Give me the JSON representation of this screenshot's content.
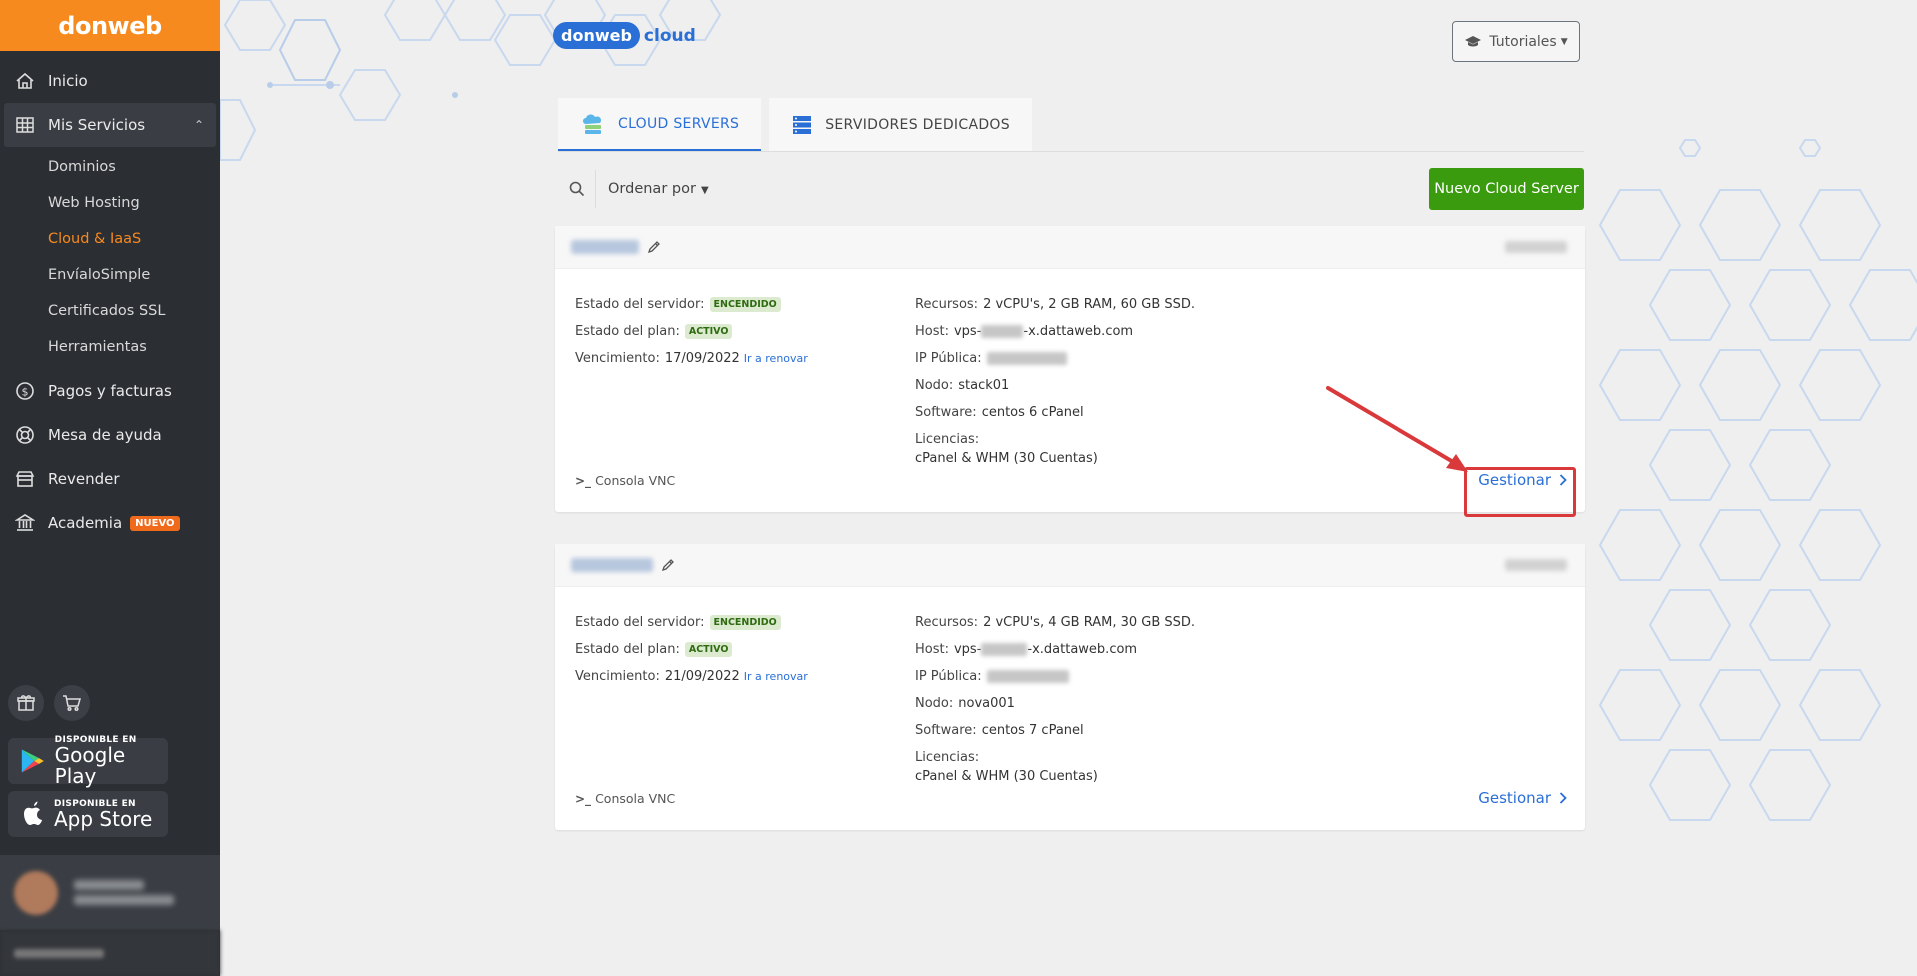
{
  "sidebar": {
    "brand": "donweb",
    "items": [
      {
        "label": "Inicio",
        "icon": "home-icon"
      },
      {
        "label": "Mis Servicios",
        "icon": "grid-icon"
      },
      {
        "label": "Pagos y facturas",
        "icon": "dollar-circle-icon"
      },
      {
        "label": "Mesa de ayuda",
        "icon": "lifebuoy-icon"
      },
      {
        "label": "Revender",
        "icon": "store-icon"
      },
      {
        "label": "Academia",
        "icon": "bank-icon",
        "badge": "NUEVO"
      }
    ],
    "submenu": [
      {
        "label": "Dominios"
      },
      {
        "label": "Web Hosting"
      },
      {
        "label": "Cloud & IaaS",
        "active": true
      },
      {
        "label": "EnvíaloSimple"
      },
      {
        "label": "Certificados SSL"
      },
      {
        "label": "Herramientas"
      }
    ],
    "google_play": {
      "small": "DISPONIBLE EN",
      "big": "Google Play"
    },
    "app_store": {
      "small": "DISPONIBLE EN",
      "big": "App Store"
    }
  },
  "header": {
    "logo_bubble": "donweb",
    "logo_text": "cloud",
    "tutorials_label": "Tutoriales"
  },
  "tabs": [
    {
      "label": "CLOUD SERVERS",
      "active": true
    },
    {
      "label": "SERVIDORES DEDICADOS",
      "active": false
    }
  ],
  "toolbar": {
    "order_label": "Ordenar por",
    "new_button": "Nuevo Cloud Server"
  },
  "labels": {
    "server_state": "Estado del servidor:",
    "plan_state": "Estado del plan:",
    "expiry": "Vencimiento:",
    "renew": "Ir a renovar",
    "resources": "Recursos:",
    "host": "Host:",
    "ip": "IP Pública:",
    "node": "Nodo:",
    "software": "Software:",
    "licenses": "Licencias:",
    "console": "Consola VNC",
    "manage": "Gestionar"
  },
  "servers": [
    {
      "server_state": "ENCENDIDO",
      "plan_state": "ACTIVO",
      "expiry": "17/09/2022",
      "resources": "2 vCPU's, 2 GB RAM, 60 GB SSD.",
      "host_prefix": "vps-",
      "host_suffix": "-x.dattaweb.com",
      "node": "stack01",
      "software": "centos 6 cPanel",
      "licenses": "cPanel & WHM (30 Cuentas)"
    },
    {
      "server_state": "ENCENDIDO",
      "plan_state": "ACTIVO",
      "expiry": "21/09/2022",
      "resources": "2 vCPU's, 4 GB RAM, 30 GB SSD.",
      "host_prefix": "vps-",
      "host_suffix": "-x.dattaweb.com",
      "node": "nova001",
      "software": "centos 7 cPanel",
      "licenses": "cPanel & WHM (30 Cuentas)"
    }
  ],
  "colors": {
    "brand_orange": "#f78a1f",
    "sidebar_bg": "#2b2e33",
    "primary_blue": "#2a6fd6",
    "success_green": "#3a9b0e",
    "annotation_red": "#d9393a"
  }
}
